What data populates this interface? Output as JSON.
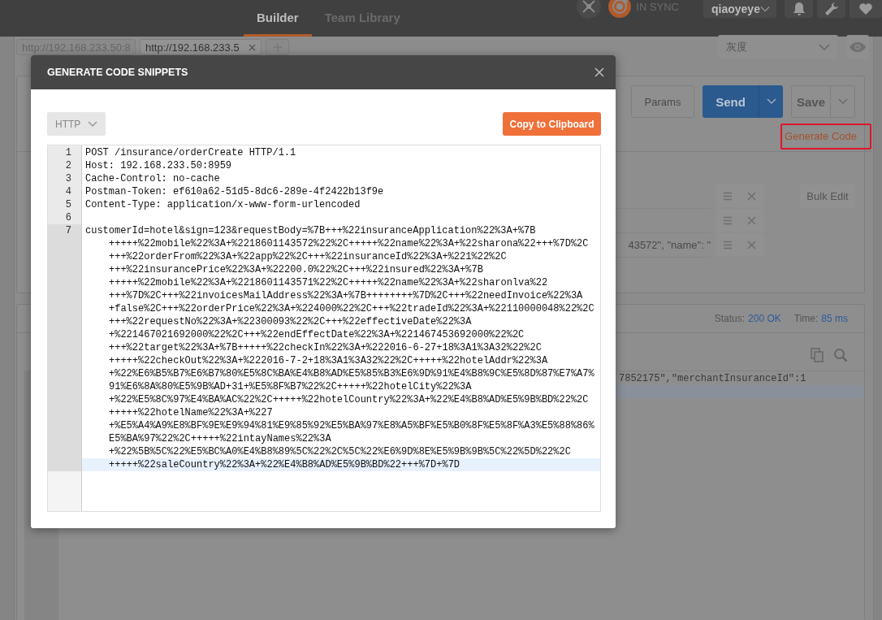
{
  "header": {
    "tabs": [
      {
        "label": "Builder",
        "selected": true
      },
      {
        "label": "Team Library",
        "selected": false
      }
    ],
    "sync_status": "IN SYNC",
    "user": "qiaoyeye"
  },
  "request_tabs": [
    {
      "label": "http://192.168.233.50:8",
      "selected": false,
      "closable": false
    },
    {
      "label": "http://192.168.233.5",
      "selected": true,
      "closable": true
    }
  ],
  "environment": "灰度",
  "request": {
    "params_button": "Params",
    "send_button": "Send",
    "save_button": "Save",
    "generate_code": "Generate Code",
    "bulk_edit": "Bulk Edit",
    "param_rows": [
      {
        "kind": "blank"
      },
      {
        "kind": "blank"
      },
      {
        "kind": "text",
        "value": "43572\",    \"name\": \""
      }
    ]
  },
  "response": {
    "status_label": "Status:",
    "status": "200 OK",
    "time_label": "Time:",
    "time": "85 ms",
    "body_line": "7852175\",\"merchantInsuranceId\":1"
  },
  "modal": {
    "title": "GENERATE CODE SNIPPETS",
    "language": "HTTP",
    "copy_button": "Copy to Clipboard",
    "code_lines": [
      {
        "number": "1",
        "active": false,
        "segments": [
          "POST /insurance/orderCreate HTTP/1.1"
        ]
      },
      {
        "number": "2",
        "active": false,
        "segments": [
          "Host: 192.168.233.50:8959"
        ]
      },
      {
        "number": "3",
        "active": false,
        "segments": [
          "Cache-Control: no-cache"
        ]
      },
      {
        "number": "4",
        "active": false,
        "segments": [
          "Postman-Token: ef610a62-51d5-8dc6-289e-4f2422b13f9e"
        ]
      },
      {
        "number": "5",
        "active": false,
        "segments": [
          "Content-Type: application/x-www-form-urlencoded"
        ]
      },
      {
        "number": "6",
        "active": false
      },
      {
        "number": "7",
        "active": true,
        "segments": [
          "customerId=hotel&sign=123&requestBody=%7B+++%22insuranceApplication%22%3A+%7B",
          "+++++%22mobile%22%3A+%2218601143572%22%2C+++++%22name%22%3A+%22sharona%22+++%7D%2C",
          "+++%22orderFrom%22%3A+%22app%22%2C+++%22insuranceId%22%3A+%221%22%2C",
          "+++%22insurancePrice%22%3A+%22200.0%22%2C+++%22insured%22%3A+%7B",
          "+++++%22mobile%22%3A+%2218601143571%22%2C+++++%22name%22%3A+%22sharonlva%22",
          "+++%7D%2C+++%22invoicesMailAddress%22%3A+%7B++++++++%7D%2C+++%22needInvoice%22%3A",
          "+false%2C+++%22orderPrice%22%3A+%224000%22%2C+++%22tradeId%22%3A+%22110000048%22%2C",
          "+++%22requestNo%22%3A+%22300093%22%2C+++%22effectiveDate%22%3A",
          "+%221467021692000%22%2C+++%22endEffectDate%22%3A+%221467453692000%22%2C",
          "+++%22target%22%3A+%7B+++++%22checkIn%22%3A+%222016-6-27+18%3A1%3A32%22%2C",
          "+++++%22checkOut%22%3A+%222016-7-2+18%3A1%3A32%22%2C+++++%22hotelAddr%22%3A",
          "+%22%E6%B5%B7%E6%B7%80%E5%8C%BA%E4%B8%AD%E5%85%B3%E6%9D%91%E4%B8%9C%E5%8D%87%E7%A7%",
          "91%E6%8A%80%E5%9B%AD+31+%E5%8F%B7%22%2C+++++%22hotelCity%22%3A",
          "+%22%E5%8C%97%E4%BA%AC%22%2C+++++%22hotelCountry%22%3A+%22%E4%B8%AD%E5%9B%BD%22%2C",
          "+++++%22hotelName%22%3A+%227",
          "+%E5%A4%A9%E8%BF%9E%E9%94%81%E9%85%92%E5%BA%97%E8%A5%BF%E5%B0%8F%E5%8F%A3%E5%88%86%",
          "E5%BA%97%22%2C+++++%22intayNames%22%3A",
          "+%22%5B%5C%22%E5%BC%A0%E4%B8%89%5C%22%2C%5C%22%E6%9D%8E%E5%9B%9B%5C%22%5D%22%2C",
          "+++++%22saleCountry%22%3A+%22%E4%B8%AD%E5%9B%BD%22+++%7D+%7D"
        ]
      }
    ]
  }
}
